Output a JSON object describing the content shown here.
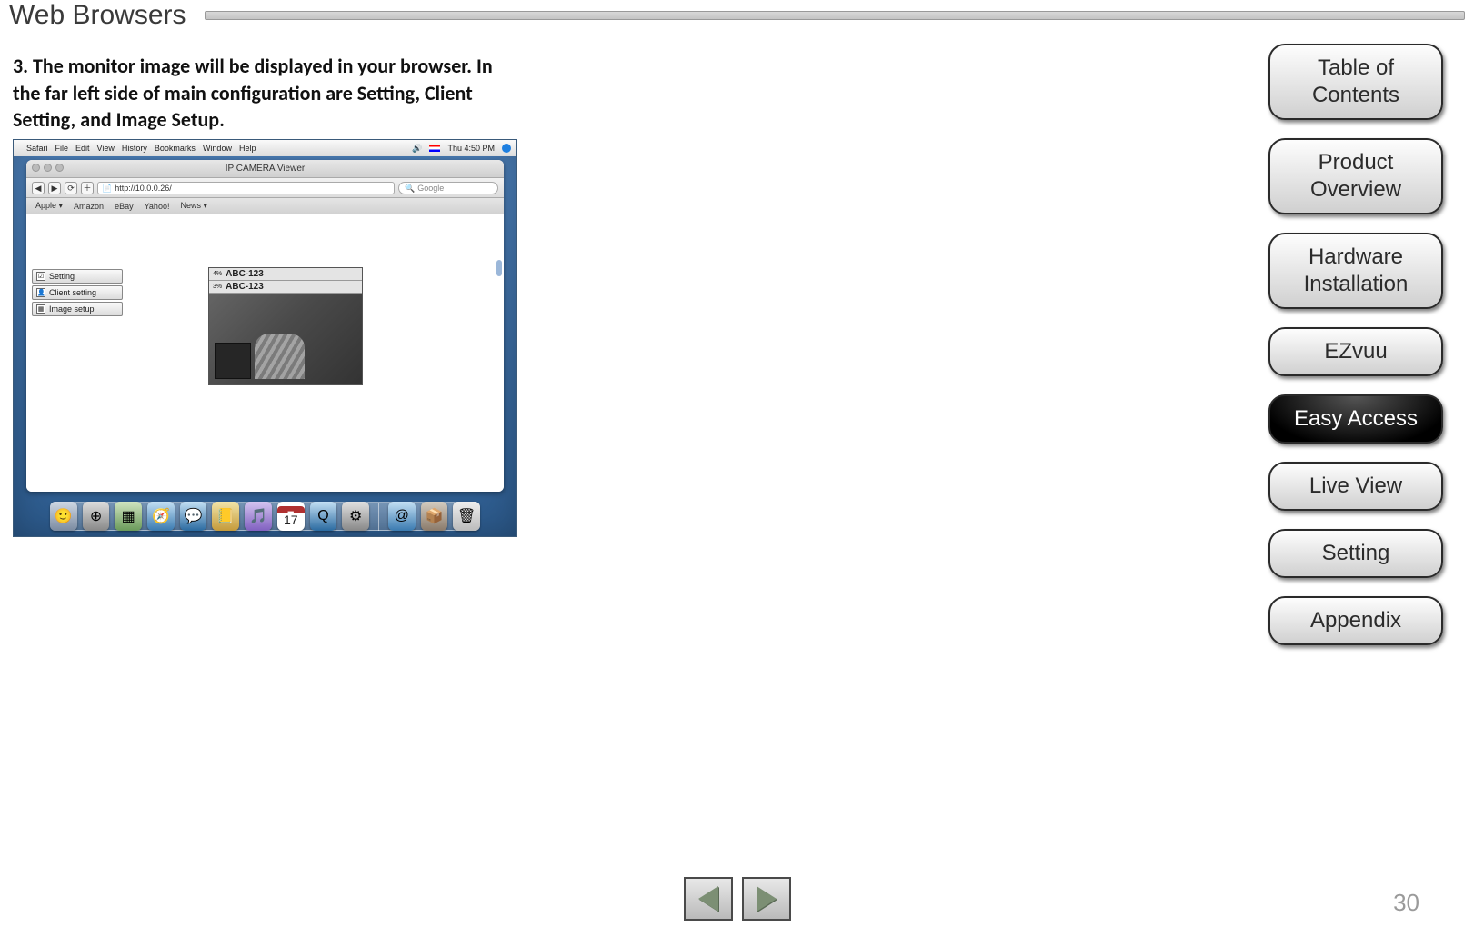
{
  "header": {
    "title": "Web Browsers"
  },
  "body": {
    "paragraph": "3. The monitor image will be displayed in your browser. In the far left side of main configuration are Setting, Client Setting, and Image Setup."
  },
  "screenshot": {
    "menubar": {
      "app": "Safari",
      "items": [
        "File",
        "Edit",
        "View",
        "History",
        "Bookmarks",
        "Window",
        "Help"
      ],
      "clock": "Thu 4:50 PM"
    },
    "window_title": "IP CAMERA Viewer",
    "url": "http://10.0.0.26/",
    "search_placeholder": "Google",
    "bookmarks": [
      "Apple ▾",
      "Amazon",
      "eBay",
      "Yahoo!",
      "News ▾"
    ],
    "config_buttons": [
      {
        "icon": "☑",
        "label": "Setting"
      },
      {
        "icon": "👤",
        "label": "Client setting"
      },
      {
        "icon": "▦",
        "label": "Image setup"
      }
    ],
    "plate_rows": [
      {
        "pct": "4%",
        "text": "ABC-123"
      },
      {
        "pct": "3%",
        "text": "ABC-123"
      }
    ],
    "calendar_day": "17"
  },
  "sidebar": {
    "items": [
      {
        "label": "Table of\nContents",
        "selected": false
      },
      {
        "label": "Product\nOverview",
        "selected": false
      },
      {
        "label": "Hardware\nInstallation",
        "selected": false
      },
      {
        "label": "EZvuu",
        "selected": false
      },
      {
        "label": "Easy Access",
        "selected": true
      },
      {
        "label": "Live View",
        "selected": false
      },
      {
        "label": "Setting",
        "selected": false
      },
      {
        "label": "Appendix",
        "selected": false
      }
    ]
  },
  "page_number": "30"
}
